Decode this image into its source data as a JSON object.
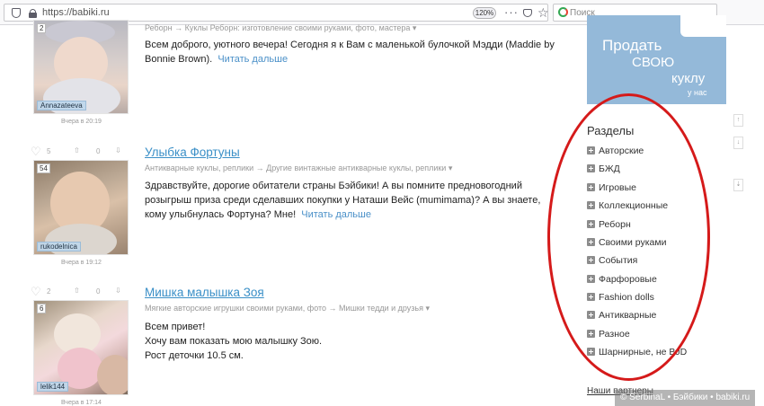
{
  "browser": {
    "url": "https://babiki.ru",
    "zoom": "120%",
    "search_placeholder": "Поиск"
  },
  "posts": [
    {
      "count": "2",
      "user": "Annazateeva",
      "time": "Вчера в 20:19",
      "crumbs": "Реборн  → Куклы Реборн: изготовление своими руками, фото, мастера",
      "text": "Всем доброго, уютного вечера! Сегодня я к Вам с маленькой булочкой Мэдди (Maddie by Bonnie Brown).",
      "more": "Читать дальше"
    },
    {
      "likes": "5",
      "views": "0",
      "title": "Улыбка Фортуны",
      "count": "54",
      "user": "rukodelnica",
      "time": "Вчера в 19:12",
      "crumbs": "Антикварные куклы, реплики  → Другие винтажные антикварные куклы, реплики",
      "text": "Здравствуйте, дорогие обитатели страны Бэйбики! А вы помните предновогодний розыгрыш приза среди сделавших покупки у Наташи Вейс (mumimama)? А вы знаете, кому улыбнулась Фортуна? Мне!",
      "more": "Читать дальше"
    },
    {
      "likes": "2",
      "views": "0",
      "title": "Мишка малышка Зоя",
      "count": "6",
      "user": "lelik144",
      "time": "Вчера в 17:14",
      "crumbs": "Мягкие авторские игрушки своими руками, фото  → Мишки тедди и друзья",
      "lines": [
        "Всем привет!",
        "Хочу вам показать мою малышку Зою.",
        "Рост деточки 10.5 см."
      ]
    }
  ],
  "banner": {
    "line1": "Продать",
    "line2": "СВОЮ",
    "line3": "куклу",
    "line4": "у нас"
  },
  "sidebar": {
    "title": "Разделы",
    "sections": [
      "Авторские",
      "БЖД",
      "Игровые",
      "Коллекционные",
      "Реборн",
      "Своими руками",
      "События",
      "Фарфоровые",
      "Fashion dolls",
      "Антикварные",
      "Разное",
      "Шарнирные, не BJD"
    ],
    "partners": "Наши партнеры"
  },
  "watermark": "© SerbinaL • Бэйбики • babiki.ru"
}
